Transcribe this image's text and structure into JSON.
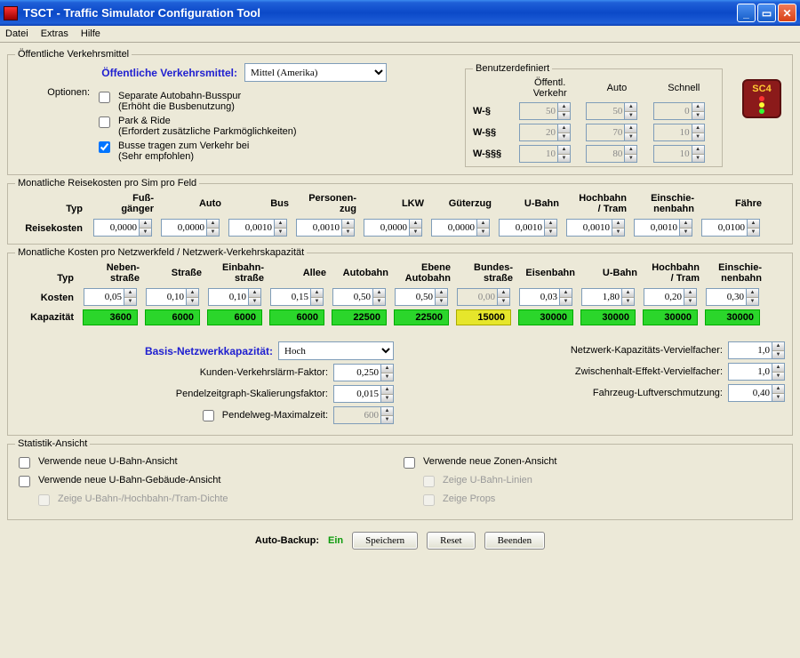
{
  "window": {
    "title": "TSCT - Traffic Simulator Configuration Tool"
  },
  "menu": {
    "file": "Datei",
    "extras": "Extras",
    "help": "Hilfe"
  },
  "section1": {
    "legend": "Öffentliche Verkehrsmittel",
    "label": "Öffentliche Verkehrsmittel:",
    "selected": "Mittel (Amerika)",
    "optionenLabel": "Optionen:",
    "opts": [
      {
        "label": "Separate Autobahn-Busspur",
        "sub": "(Erhöht die Busbenutzung)",
        "checked": false
      },
      {
        "label": "Park & Ride",
        "sub": "(Erfordert zusätzliche Parkmöglichkeiten)",
        "checked": false
      },
      {
        "label": "Busse tragen zum Verkehr bei",
        "sub": "(Sehr empfohlen)",
        "checked": true
      }
    ],
    "benutz": {
      "legend": "Benutzerdefiniert",
      "cols": [
        "Öffentl. Verkehr",
        "Auto",
        "Schnell"
      ],
      "rows": [
        {
          "name": "W-§",
          "v": [
            "50",
            "50",
            "0"
          ]
        },
        {
          "name": "W-§§",
          "v": [
            "20",
            "70",
            "10"
          ]
        },
        {
          "name": "W-§§§",
          "v": [
            "10",
            "80",
            "10"
          ]
        }
      ]
    }
  },
  "section2": {
    "legend": "Monatliche Reisekosten pro Sim pro Feld",
    "typ": "Typ",
    "rowlabel": "Reisekosten",
    "cols": [
      {
        "l1": "Fuß-",
        "l2": "gänger"
      },
      {
        "l1": "",
        "l2": "Auto"
      },
      {
        "l1": "",
        "l2": "Bus"
      },
      {
        "l1": "Personen-",
        "l2": "zug"
      },
      {
        "l1": "",
        "l2": "LKW"
      },
      {
        "l1": "",
        "l2": "Güterzug"
      },
      {
        "l1": "",
        "l2": "U-Bahn"
      },
      {
        "l1": "Hochbahn",
        "l2": "/ Tram"
      },
      {
        "l1": "Einschie-",
        "l2": "nenbahn"
      },
      {
        "l1": "",
        "l2": "Fähre"
      }
    ],
    "vals": [
      "0,0000",
      "0,0000",
      "0,0010",
      "0,0010",
      "0,0000",
      "0,0000",
      "0,0010",
      "0,0010",
      "0,0010",
      "0,0100"
    ]
  },
  "section3": {
    "legend": "Monatliche Kosten pro Netzwerkfeld / Netzwerk-Verkehrskapazität",
    "typ": "Typ",
    "kosten": "Kosten",
    "kap": "Kapazität",
    "cols": [
      {
        "l1": "Neben-",
        "l2": "straße"
      },
      {
        "l1": "",
        "l2": "Straße"
      },
      {
        "l1": "Einbahn-",
        "l2": "straße"
      },
      {
        "l1": "",
        "l2": "Allee"
      },
      {
        "l1": "",
        "l2": "Autobahn"
      },
      {
        "l1": "Ebene",
        "l2": "Autobahn"
      },
      {
        "l1": "Bundes-",
        "l2": "straße"
      },
      {
        "l1": "",
        "l2": "Eisenbahn"
      },
      {
        "l1": "",
        "l2": "U-Bahn"
      },
      {
        "l1": "Hochbahn",
        "l2": "/ Tram"
      },
      {
        "l1": "Einschie-",
        "l2": "nenbahn"
      }
    ],
    "kostenVals": [
      "0,05",
      "0,10",
      "0,10",
      "0,15",
      "0,50",
      "0,50",
      "0,00",
      "0,03",
      "1,80",
      "0,20",
      "0,30"
    ],
    "kostenDis": [
      false,
      false,
      false,
      false,
      false,
      false,
      true,
      false,
      false,
      false,
      false
    ],
    "kapVals": [
      "3600",
      "6000",
      "6000",
      "6000",
      "22500",
      "22500",
      "15000",
      "30000",
      "30000",
      "30000",
      "30000"
    ],
    "kapColor": [
      "g",
      "g",
      "g",
      "g",
      "g",
      "g",
      "y",
      "g",
      "g",
      "g",
      "g"
    ],
    "basisLabel": "Basis-Netzwerkkapazität:",
    "basisVal": "Hoch",
    "leftParams": [
      {
        "lab": "Kunden-Verkehrslärm-Faktor:",
        "val": "0,250"
      },
      {
        "lab": "Pendelzeitgraph-Skalierungsfaktor:",
        "val": "0,015"
      }
    ],
    "pendelCheck": "Pendelweg-Maximalzeit:",
    "pendelVal": "600",
    "rightParams": [
      {
        "lab": "Netzwerk-Kapazitäts-Vervielfacher:",
        "val": "1,0"
      },
      {
        "lab": "Zwischenhalt-Effekt-Vervielfacher:",
        "val": "1,0"
      },
      {
        "lab": "Fahrzeug-Luftverschmutzung:",
        "val": "0,40"
      }
    ]
  },
  "section4": {
    "legend": "Statistik-Ansicht",
    "left": [
      {
        "t": "Verwende neue U-Bahn-Ansicht",
        "c": false,
        "d": false
      },
      {
        "t": "Verwende neue U-Bahn-Gebäude-Ansicht",
        "c": false,
        "d": false
      },
      {
        "t": "Zeige U-Bahn-/Hochbahn-/Tram-Dichte",
        "c": false,
        "d": true
      }
    ],
    "right": [
      {
        "t": "Verwende neue Zonen-Ansicht",
        "c": false,
        "d": false
      },
      {
        "t": "Zeige U-Bahn-Linien",
        "c": false,
        "d": true
      },
      {
        "t": "Zeige Props",
        "c": false,
        "d": true
      }
    ]
  },
  "bottom": {
    "autobackup": "Auto-Backup:",
    "ein": "Ein",
    "save": "Speichern",
    "reset": "Reset",
    "quit": "Beenden"
  }
}
